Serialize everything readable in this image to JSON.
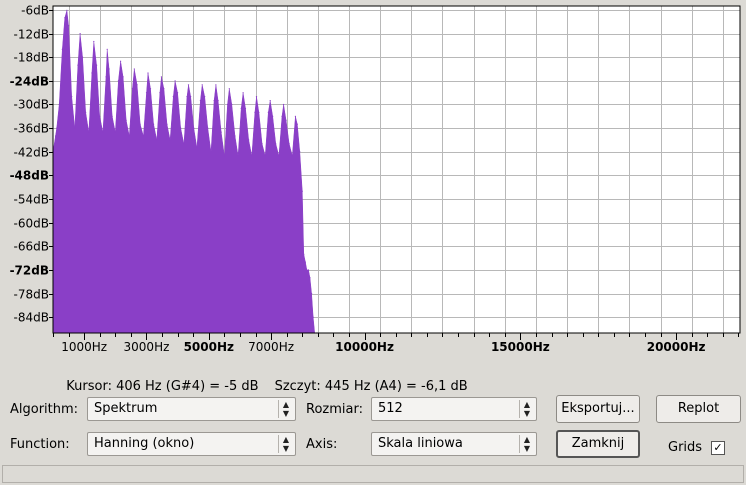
{
  "chart_data": {
    "type": "area",
    "color": "#8a3fc7",
    "plot_background": "#ffffff",
    "grid": true,
    "y_scale": "dB",
    "ylim": [
      -88,
      -5
    ],
    "xlim": [
      0,
      22050
    ],
    "y_ticks": [
      {
        "value": -6,
        "label": "-6dB",
        "bold": false
      },
      {
        "value": -12,
        "label": "-12dB",
        "bold": false
      },
      {
        "value": -18,
        "label": "-18dB",
        "bold": false
      },
      {
        "value": -24,
        "label": "-24dB",
        "bold": true
      },
      {
        "value": -30,
        "label": "-30dB",
        "bold": false
      },
      {
        "value": -36,
        "label": "-36dB",
        "bold": false
      },
      {
        "value": -42,
        "label": "-42dB",
        "bold": false
      },
      {
        "value": -48,
        "label": "-48dB",
        "bold": true
      },
      {
        "value": -54,
        "label": "-54dB",
        "bold": false
      },
      {
        "value": -60,
        "label": "-60dB",
        "bold": false
      },
      {
        "value": -66,
        "label": "-66dB",
        "bold": false
      },
      {
        "value": -72,
        "label": "-72dB",
        "bold": true
      },
      {
        "value": -78,
        "label": "-78dB",
        "bold": false
      },
      {
        "value": -84,
        "label": "-84dB",
        "bold": false
      }
    ],
    "x_ticks": [
      {
        "value": 1000,
        "label": "1000Hz",
        "bold": false
      },
      {
        "value": 3000,
        "label": "3000Hz",
        "bold": false
      },
      {
        "value": 5000,
        "label": "5000Hz",
        "bold": true
      },
      {
        "value": 7000,
        "label": "7000Hz",
        "bold": false
      },
      {
        "value": 10000,
        "label": "10000Hz",
        "bold": true
      },
      {
        "value": 15000,
        "label": "15000Hz",
        "bold": true
      },
      {
        "value": 20000,
        "label": "20000Hz",
        "bold": true
      }
    ],
    "x": [
      0,
      80,
      120,
      200,
      300,
      380,
      445,
      500,
      600,
      700,
      800,
      870,
      950,
      1050,
      1150,
      1250,
      1310,
      1400,
      1500,
      1600,
      1700,
      1740,
      1800,
      1900,
      2000,
      2100,
      2170,
      2250,
      2350,
      2450,
      2550,
      2610,
      2700,
      2800,
      2900,
      3000,
      3050,
      3130,
      3230,
      3330,
      3430,
      3480,
      3560,
      3660,
      3760,
      3860,
      3920,
      4000,
      4100,
      4200,
      4300,
      4350,
      4420,
      4520,
      4620,
      4730,
      4790,
      4870,
      4970,
      5070,
      5170,
      5230,
      5300,
      5400,
      5500,
      5600,
      5660,
      5740,
      5840,
      5940,
      6040,
      6100,
      6180,
      6280,
      6380,
      6480,
      6530,
      6610,
      6710,
      6810,
      6910,
      6970,
      7050,
      7150,
      7250,
      7350,
      7400,
      7480,
      7580,
      7680,
      7780,
      7840,
      7920,
      8000,
      8050,
      8100,
      8150,
      8200,
      8250,
      8300,
      8350,
      8400,
      8450,
      8500
    ],
    "y": [
      -42,
      -38,
      -36,
      -30,
      -16,
      -8,
      -6.1,
      -10,
      -28,
      -36,
      -20,
      -12,
      -18,
      -32,
      -37,
      -22,
      -14,
      -20,
      -33,
      -37,
      -23,
      -16,
      -21,
      -33,
      -37,
      -24,
      -19,
      -23,
      -34,
      -38,
      -26,
      -21,
      -25,
      -35,
      -38,
      -27,
      -22,
      -26,
      -35,
      -39,
      -27,
      -23,
      -26,
      -35,
      -39,
      -28,
      -24,
      -27,
      -36,
      -40,
      -28,
      -25,
      -28,
      -36,
      -41,
      -29,
      -25,
      -28,
      -36,
      -42,
      -29,
      -25,
      -29,
      -37,
      -43,
      -30,
      -26,
      -30,
      -38,
      -43,
      -31,
      -27,
      -31,
      -39,
      -43,
      -32,
      -28,
      -32,
      -40,
      -43,
      -32,
      -29,
      -33,
      -40,
      -43,
      -33,
      -30,
      -34,
      -40,
      -43,
      -33,
      -35,
      -42,
      -52,
      -68,
      -70,
      -72,
      -72,
      -74,
      -78,
      -84,
      -88,
      -88,
      -88
    ]
  },
  "status": {
    "cursor": "Kursor: 406 Hz (G#4) = -5 dB",
    "peak": "Szczyt: 445 Hz (A4) = -6,1 dB"
  },
  "controls": {
    "algorithm_label": "Algorithm:",
    "algorithm_value": "Spektrum",
    "size_label": "Rozmiar:",
    "size_value": "512",
    "function_label": "Function:",
    "function_value": "Hanning (okno)",
    "axis_label": "Axis:",
    "axis_value": "Skala liniowa",
    "export_label": "Eksportuj...",
    "replot_label": "Replot",
    "close_label": "Zamknij",
    "grids_label": "Grids",
    "grids_checked": true,
    "check_mark": "✓",
    "spin_up": "▲",
    "spin_down": "▼"
  }
}
